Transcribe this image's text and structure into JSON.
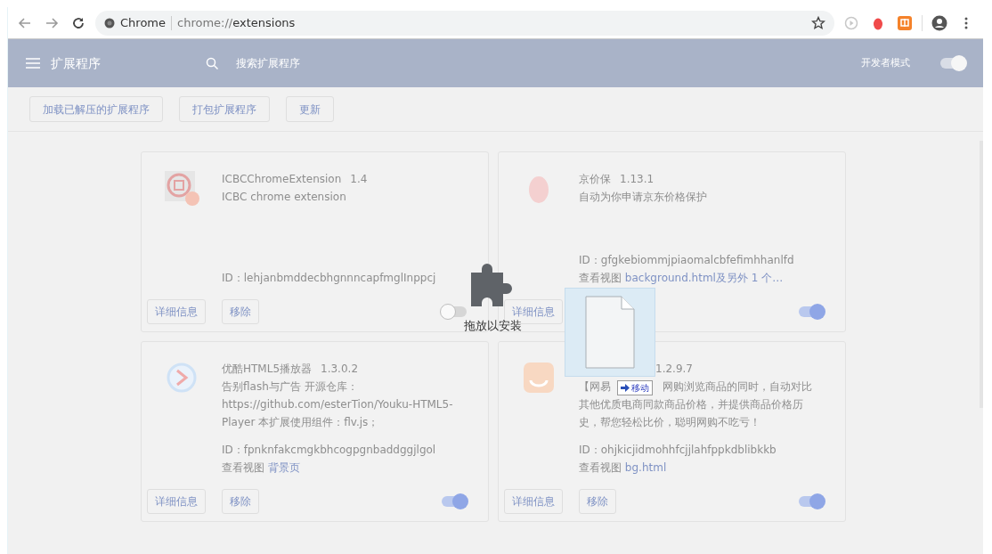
{
  "browser": {
    "origin": "Chrome",
    "url_prefix": "chrome://",
    "url_path": "extensions"
  },
  "header": {
    "title": "扩展程序",
    "search_placeholder": "搜索扩展程序",
    "dev_mode_label": "开发者模式",
    "dev_mode_on": true
  },
  "toolbar_buttons": [
    "加载已解压的扩展程序",
    "打包扩展程序",
    "更新"
  ],
  "extensions": [
    {
      "name": "ICBCChromeExtension",
      "version": "1.4",
      "description_lines": [
        [
          "ICBC chrome extension"
        ]
      ],
      "id": "ID：lehjanbmddecbhgnnncapfmglInppcj",
      "details_button": "详细信息",
      "remove_button": "移除",
      "enabled": false
    },
    {
      "name": "京价保",
      "version": "1.13.1",
      "description_lines": [
        [
          "自动为你申请京东价格保护"
        ]
      ],
      "id": "ID：gfgkebiommjpiaomalcbfefimhhanlfd",
      "views_label": "查看视图",
      "views_link": "background.html及另外 1 个…",
      "details_button": "详细信息",
      "enabled": true
    },
    {
      "name": "优酷HTML5播放器",
      "version": "1.3.0.2",
      "description_lines": [
        [
          "告别flash与广告 开源仓库："
        ],
        [
          "https://github.com/esterTion/Youku-HTML5-"
        ],
        [
          "Player 本扩展使用组件：flv.js；"
        ]
      ],
      "id": "ID：fpnknfakcmgkbhcogpgnbaddggjlgol",
      "views_label": "查看视图",
      "views_link": "背景页",
      "details_button": "详细信息",
      "remove_button": "移除",
      "enabled": true
    },
    {
      "version": "1.2.9.7",
      "description_lines": [
        [
          "【网易",
          "网购浏览商品的同时，自动对比"
        ],
        [
          "其他优质电商同款商品价格，并提供商品价格历"
        ],
        [
          "史，帮您轻松比价，聪明网购不吃亏！"
        ]
      ],
      "id": "ID：ohjkicjidmohhfcjjlahfppkdblibkkb",
      "views_label": "查看视图",
      "views_link": "bg.html",
      "details_button": "详细信息",
      "remove_button": "移除",
      "enabled": true
    }
  ],
  "drop_overlay": {
    "label": "拖放以安装"
  },
  "drag_image": {
    "badge": "移动"
  }
}
